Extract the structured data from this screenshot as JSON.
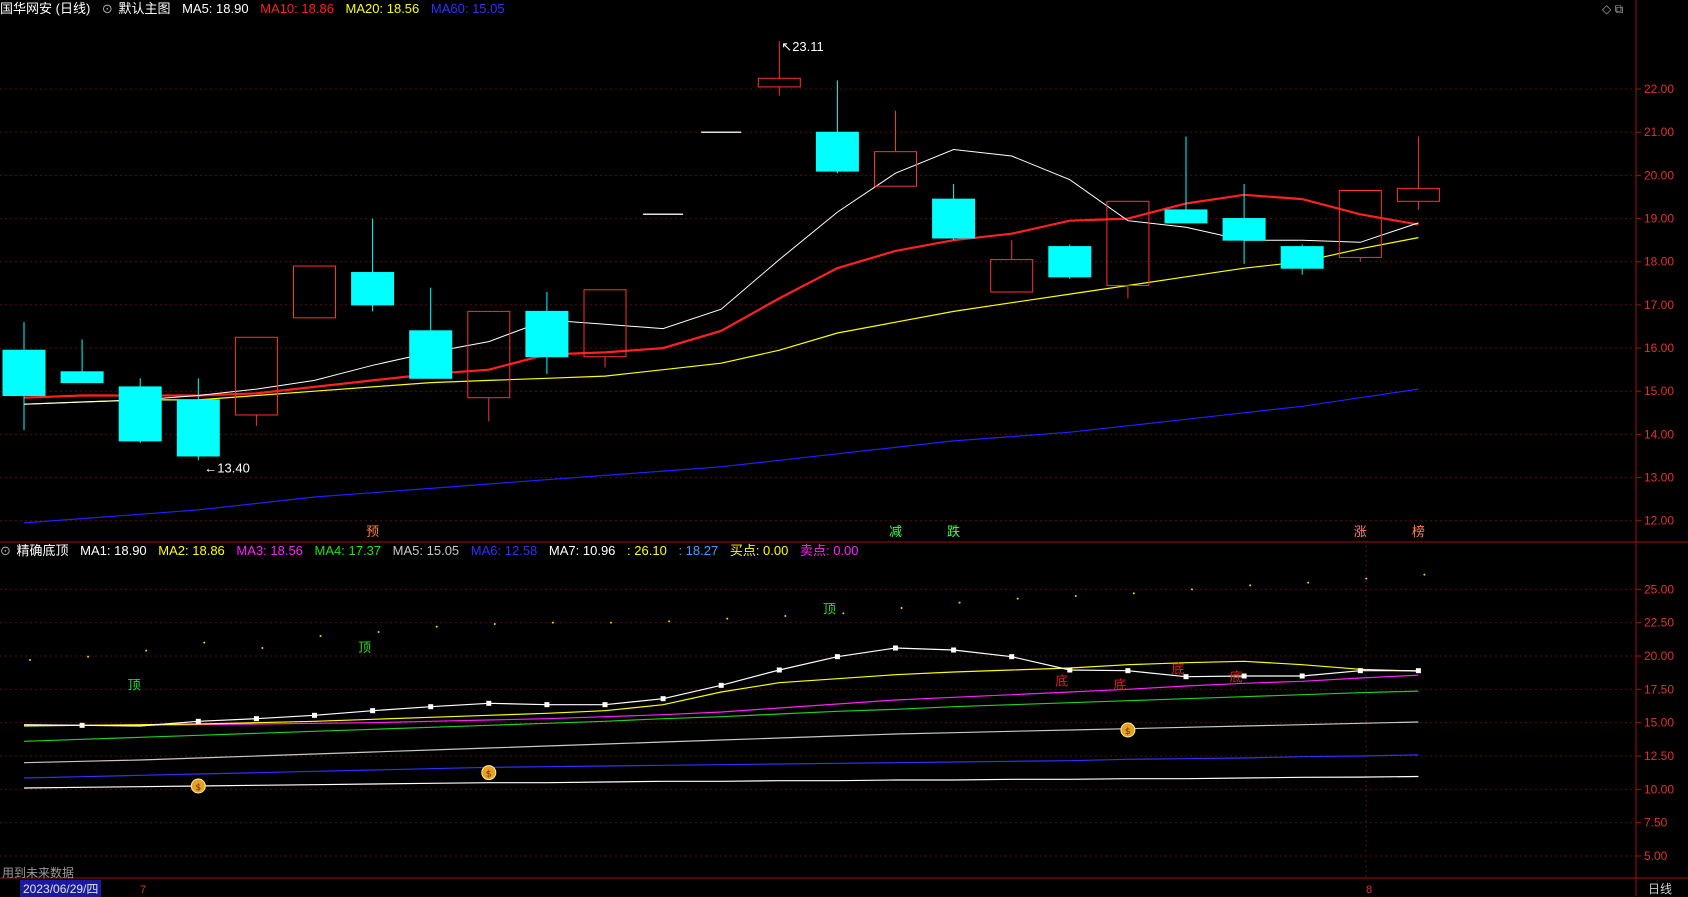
{
  "header": {
    "title": "国华网安 (日线)",
    "indicator": "默认主图",
    "ma5": "MA5: 18.90",
    "ma10": "MA10: 18.86",
    "ma20": "MA20: 18.56",
    "ma60": "MA60: 15.05",
    "colors": {
      "ma5": "#ffffff",
      "ma10": "#ff2020",
      "ma20": "#ffff00",
      "ma60": "#2020ff"
    }
  },
  "sub_header": {
    "indicator": "精确底顶",
    "ma1": "MA1: 18.90",
    "ma2": "MA2: 18.86",
    "ma3": "MA3: 18.56",
    "ma4": "MA4: 17.37",
    "ma5": "MA5: 15.05",
    "ma6": "MA6: 12.58",
    "ma7": "MA7: 10.96",
    "v1": ": 26.10",
    "v2": ": 18.27",
    "buy": "买点: 0.00",
    "sell": "卖点: 0.00"
  },
  "footer": {
    "future_note": "用到未来数据",
    "date": "2023/06/29/四",
    "period": "日线"
  },
  "chart_data": [
    {
      "type": "candlestick",
      "candles": [
        {
          "o": 15.95,
          "h": 16.6,
          "l": 14.1,
          "c": 14.9,
          "dir": "down"
        },
        {
          "o": 15.45,
          "h": 16.2,
          "l": 15.2,
          "c": 15.2,
          "dir": "down"
        },
        {
          "o": 15.1,
          "h": 15.3,
          "l": 13.8,
          "c": 13.85,
          "dir": "down"
        },
        {
          "o": 14.8,
          "h": 15.3,
          "l": 13.4,
          "c": 13.5,
          "dir": "down"
        },
        {
          "o": 14.45,
          "h": 16.25,
          "l": 14.2,
          "c": 16.25,
          "dir": "up"
        },
        {
          "o": 16.7,
          "h": 17.9,
          "l": 16.7,
          "c": 17.9,
          "dir": "up"
        },
        {
          "o": 17.75,
          "h": 19.0,
          "l": 16.85,
          "c": 17.0,
          "dir": "down"
        },
        {
          "o": 16.4,
          "h": 17.4,
          "l": 15.3,
          "c": 15.3,
          "dir": "down"
        },
        {
          "o": 14.85,
          "h": 16.85,
          "l": 14.3,
          "c": 16.85,
          "dir": "up"
        },
        {
          "o": 16.85,
          "h": 17.3,
          "l": 15.4,
          "c": 15.8,
          "dir": "down"
        },
        {
          "o": 15.8,
          "h": 17.35,
          "l": 15.55,
          "c": 17.35,
          "dir": "up"
        },
        {
          "o": 19.1,
          "h": 19.1,
          "l": 19.1,
          "c": 19.1,
          "dir": "flat"
        },
        {
          "o": 21.0,
          "h": 21.0,
          "l": 21.0,
          "c": 21.0,
          "dir": "flat"
        },
        {
          "o": 22.05,
          "h": 23.11,
          "l": 21.85,
          "c": 22.25,
          "dir": "up"
        },
        {
          "o": 21.0,
          "h": 22.2,
          "l": 20.05,
          "c": 20.1,
          "dir": "down"
        },
        {
          "o": 19.75,
          "h": 21.5,
          "l": 19.75,
          "c": 20.55,
          "dir": "up"
        },
        {
          "o": 19.45,
          "h": 19.8,
          "l": 18.5,
          "c": 18.55,
          "dir": "down"
        },
        {
          "o": 17.3,
          "h": 18.5,
          "l": 17.3,
          "c": 18.05,
          "dir": "up"
        },
        {
          "o": 18.35,
          "h": 18.4,
          "l": 17.6,
          "c": 17.65,
          "dir": "down"
        },
        {
          "o": 17.45,
          "h": 19.4,
          "l": 17.15,
          "c": 19.4,
          "dir": "up"
        },
        {
          "o": 19.2,
          "h": 20.9,
          "l": 18.95,
          "c": 18.9,
          "dir": "down"
        },
        {
          "o": 19.0,
          "h": 19.8,
          "l": 17.95,
          "c": 18.5,
          "dir": "down"
        },
        {
          "o": 18.35,
          "h": 18.4,
          "l": 17.7,
          "c": 17.85,
          "dir": "down"
        },
        {
          "o": 18.1,
          "h": 19.65,
          "l": 18.0,
          "c": 19.65,
          "dir": "up"
        },
        {
          "o": 19.4,
          "h": 20.9,
          "l": 19.2,
          "c": 19.7,
          "dir": "up"
        }
      ],
      "ma5": [
        14.7,
        14.75,
        14.8,
        14.9,
        15.05,
        15.25,
        15.6,
        15.9,
        16.15,
        16.65,
        16.55,
        16.45,
        16.9,
        18.05,
        19.15,
        20.05,
        20.6,
        20.45,
        19.9,
        18.95,
        18.8,
        18.5,
        18.5,
        18.45,
        18.9
      ],
      "ma10": [
        14.85,
        14.9,
        14.9,
        14.9,
        14.95,
        15.1,
        15.25,
        15.4,
        15.5,
        15.85,
        15.9,
        16.0,
        16.4,
        17.15,
        17.85,
        18.25,
        18.5,
        18.65,
        18.95,
        19.0,
        19.35,
        19.55,
        19.45,
        19.1,
        18.86
      ],
      "ma20": [
        14.7,
        14.75,
        14.8,
        14.8,
        14.9,
        15.0,
        15.1,
        15.2,
        15.25,
        15.3,
        15.35,
        15.5,
        15.65,
        15.95,
        16.35,
        16.6,
        16.85,
        17.05,
        17.25,
        17.45,
        17.65,
        17.85,
        18.0,
        18.3,
        18.56
      ],
      "ma60": [
        11.95,
        12.05,
        12.15,
        12.25,
        12.4,
        12.55,
        12.65,
        12.75,
        12.85,
        12.95,
        13.05,
        13.15,
        13.25,
        13.4,
        13.55,
        13.7,
        13.85,
        13.95,
        14.05,
        14.2,
        14.35,
        14.5,
        14.65,
        14.85,
        15.05
      ],
      "y_ticks": [
        "12.00",
        "13.00",
        "14.00",
        "15.00",
        "16.00",
        "17.00",
        "18.00",
        "19.00",
        "20.00",
        "21.00",
        "22.00"
      ],
      "ylim": [
        11.6,
        23.6
      ],
      "annotations": {
        "high": "23.11",
        "low": "13.40"
      },
      "signals": [
        {
          "i": 6,
          "text": "预",
          "color": "#ff8040"
        },
        {
          "i": 15,
          "text": "减",
          "color": "#40ff40"
        },
        {
          "i": 16,
          "text": "跌",
          "color": "#40ff40"
        },
        {
          "i": 23,
          "text": "涨",
          "color": "#ff8080"
        },
        {
          "i": 24,
          "text": "榜",
          "color": "#ff8040"
        }
      ]
    },
    {
      "type": "line",
      "series": [
        {
          "key": "ma1",
          "color": "#ffffff",
          "values": [
            14.85,
            14.8,
            14.75,
            15.1,
            15.3,
            15.55,
            15.9,
            16.2,
            16.45,
            16.35,
            16.35,
            16.8,
            17.8,
            18.95,
            19.95,
            20.6,
            20.45,
            19.95,
            18.95,
            18.9,
            18.45,
            18.5,
            18.5,
            18.9,
            18.9
          ]
        },
        {
          "key": "ma2",
          "color": "#ffff00",
          "values": [
            14.75,
            14.8,
            14.85,
            14.9,
            15.0,
            15.1,
            15.25,
            15.4,
            15.55,
            15.7,
            15.9,
            16.35,
            17.3,
            18.0,
            18.3,
            18.6,
            18.8,
            18.95,
            19.1,
            19.35,
            19.5,
            19.6,
            19.35,
            19.0,
            18.86
          ]
        },
        {
          "key": "ma3",
          "color": "#ff20ff",
          "values": [
            14.8,
            14.8,
            14.8,
            14.85,
            14.9,
            14.95,
            15.0,
            15.1,
            15.2,
            15.3,
            15.45,
            15.6,
            15.8,
            16.1,
            16.4,
            16.7,
            16.9,
            17.1,
            17.3,
            17.5,
            17.75,
            17.95,
            18.1,
            18.35,
            18.56
          ]
        },
        {
          "key": "ma4",
          "color": "#20d020",
          "values": [
            13.6,
            13.75,
            13.9,
            14.05,
            14.2,
            14.35,
            14.5,
            14.65,
            14.8,
            14.95,
            15.1,
            15.3,
            15.45,
            15.65,
            15.85,
            16.0,
            16.2,
            16.35,
            16.5,
            16.65,
            16.8,
            16.95,
            17.1,
            17.25,
            17.37
          ]
        },
        {
          "key": "ma5",
          "color": "#c8c8c8",
          "values": [
            12.0,
            12.1,
            12.2,
            12.35,
            12.5,
            12.65,
            12.8,
            12.95,
            13.1,
            13.25,
            13.4,
            13.55,
            13.7,
            13.85,
            14.0,
            14.15,
            14.25,
            14.35,
            14.45,
            14.55,
            14.65,
            14.75,
            14.85,
            14.95,
            15.05
          ]
        },
        {
          "key": "ma6",
          "color": "#3030ff",
          "values": [
            10.85,
            10.95,
            11.05,
            11.15,
            11.25,
            11.35,
            11.45,
            11.55,
            11.65,
            11.7,
            11.75,
            11.8,
            11.85,
            11.9,
            11.95,
            12.0,
            12.05,
            12.1,
            12.15,
            12.25,
            12.3,
            12.35,
            12.45,
            12.5,
            12.58
          ]
        },
        {
          "key": "ma7",
          "color": "#ffffff",
          "values": [
            10.1,
            10.15,
            10.2,
            10.25,
            10.3,
            10.35,
            10.4,
            10.45,
            10.5,
            10.5,
            10.55,
            10.6,
            10.6,
            10.65,
            10.65,
            10.7,
            10.7,
            10.75,
            10.75,
            10.8,
            10.8,
            10.85,
            10.9,
            10.92,
            10.96
          ]
        }
      ],
      "dots": [
        19.7,
        19.95,
        20.4,
        21.0,
        20.6,
        21.5,
        21.8,
        22.2,
        22.4,
        22.5,
        22.5,
        22.6,
        22.8,
        23.0,
        23.2,
        23.6,
        24.0,
        24.3,
        24.5,
        24.7,
        25.0,
        25.3,
        25.5,
        25.8,
        26.1
      ],
      "markers": [
        {
          "i": 1,
          "text": "顶",
          "color": "#20e020",
          "y": 17.5
        },
        {
          "i": 6,
          "text": "顶",
          "color": "#20e020",
          "y": 20.3
        },
        {
          "i": 14,
          "text": "顶",
          "color": "#20e020",
          "y": 23.2
        },
        {
          "i": 18,
          "text": "底",
          "color": "#e02020",
          "y": 17.8
        },
        {
          "i": 19,
          "text": "底",
          "color": "#e02020",
          "y": 17.5
        },
        {
          "i": 20,
          "text": "底",
          "color": "#e02020",
          "y": 18.7
        },
        {
          "i": 21,
          "text": "底",
          "color": "#e02020",
          "y": 18.1
        }
      ],
      "money_bags": [
        3,
        8,
        19
      ],
      "y_ticks": [
        "5.00",
        "7.50",
        "10.00",
        "12.50",
        "15.00",
        "17.50",
        "20.00",
        "22.50",
        "25.00"
      ],
      "ylim": [
        3.2,
        27.2
      ]
    }
  ]
}
